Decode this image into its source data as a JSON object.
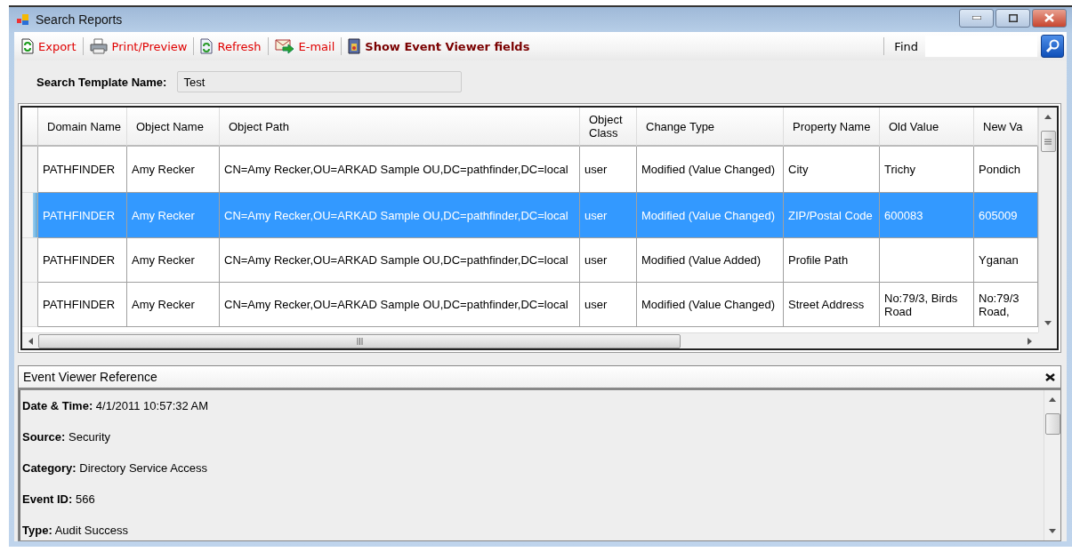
{
  "window": {
    "title": "Search Reports"
  },
  "toolbar": {
    "items": [
      {
        "label": "Export",
        "kind": "action"
      },
      {
        "label": "Print/Preview",
        "kind": "action"
      },
      {
        "label": "Refresh",
        "kind": "action"
      },
      {
        "label": "E-mail",
        "kind": "action"
      },
      {
        "label": "Show Event Viewer fields",
        "kind": "toggle"
      }
    ],
    "find": {
      "label": "Find"
    }
  },
  "search_template": {
    "label": "Search Template Name:",
    "value": "Test"
  },
  "table": {
    "columns": [
      "Domain Name",
      "Object Name",
      "Object Path",
      "Object Class",
      "Change Type",
      "Property Name",
      "Old Value",
      "New Va"
    ],
    "rows": [
      {
        "selected": false,
        "cells": [
          "PATHFINDER",
          "Amy Recker",
          "CN=Amy Recker,OU=ARKAD Sample OU,DC=pathfinder,DC=local",
          "user",
          "Modified (Value Changed)",
          "City",
          "Trichy",
          "Pondich"
        ]
      },
      {
        "selected": true,
        "cells": [
          "PATHFINDER",
          "Amy Recker",
          "CN=Amy Recker,OU=ARKAD Sample OU,DC=pathfinder,DC=local",
          "user",
          "Modified (Value Changed)",
          "ZIP/Postal Code",
          "600083",
          "605009"
        ]
      },
      {
        "selected": false,
        "cells": [
          "PATHFINDER",
          "Amy Recker",
          "CN=Amy Recker,OU=ARKAD Sample OU,DC=pathfinder,DC=local",
          "user",
          "Modified (Value Added)",
          "Profile Path",
          "",
          "Yganan"
        ]
      },
      {
        "selected": false,
        "cells": [
          "PATHFINDER",
          "Amy Recker",
          "CN=Amy Recker,OU=ARKAD Sample OU,DC=pathfinder,DC=local",
          "user",
          "Modified (Value Changed)",
          "Street Address",
          "No:79/3, Birds Road",
          "No:79/3 Road,"
        ]
      }
    ]
  },
  "event_panel": {
    "title": "Event Viewer Reference",
    "fields": [
      {
        "label": "Date & Time:",
        "value": "4/1/2011 10:57:32 AM"
      },
      {
        "label": "Source:",
        "value": "Security"
      },
      {
        "label": "Category:",
        "value": "Directory Service Access"
      },
      {
        "label": "Event ID:",
        "value": "566"
      },
      {
        "label": "Type:",
        "value": "Audit Success"
      }
    ]
  }
}
